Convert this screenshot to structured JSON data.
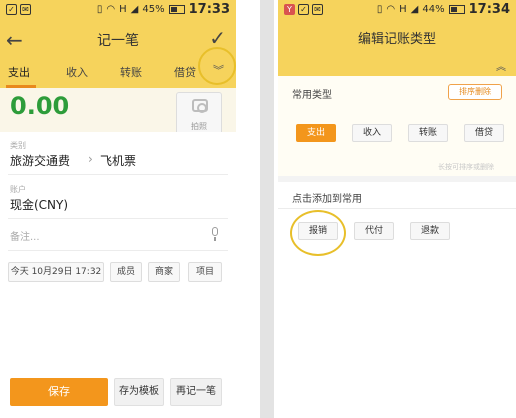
{
  "left_screen": {
    "status_bar": {
      "signal_label": "H",
      "battery_percent": "45%",
      "time": "17:33"
    },
    "header": {
      "title": "记一笔"
    },
    "tabs": [
      {
        "label": "支出",
        "active": true
      },
      {
        "label": "收入",
        "active": false
      },
      {
        "label": "转账",
        "active": false
      },
      {
        "label": "借贷",
        "active": false
      }
    ],
    "amount": "0.00",
    "photo_label": "拍照",
    "category": {
      "label": "类别",
      "main": "旅游交通费",
      "sub": "飞机票"
    },
    "account": {
      "label": "账户",
      "value": "现金(CNY)"
    },
    "note": {
      "placeholder": "备注..."
    },
    "chips": {
      "date": "今天 10月29日 17:32",
      "member": "成员",
      "merchant": "商家",
      "project": "项目"
    },
    "buttons": {
      "save": "保存",
      "save_template": "存为模板",
      "again": "再记一笔"
    }
  },
  "right_screen": {
    "status_bar": {
      "signal_label": "H",
      "battery_percent": "44%",
      "time": "17:34"
    },
    "header": {
      "title": "编辑记账类型"
    },
    "common_types": {
      "title": "常用类型",
      "sort_button": "排序删除",
      "items": [
        {
          "label": "支出",
          "active": true
        },
        {
          "label": "收入",
          "active": false
        },
        {
          "label": "转账",
          "active": false
        },
        {
          "label": "借贷",
          "active": false
        }
      ],
      "hint": "长按可排序或删除"
    },
    "add_section": {
      "title": "点击添加到常用",
      "items": [
        {
          "label": "报销"
        },
        {
          "label": "代付"
        },
        {
          "label": "退款"
        }
      ]
    }
  },
  "colors": {
    "header_yellow": "#f6d35c",
    "accent_orange": "#f3961c",
    "amount_green": "#2d9c3a",
    "callout_yellow": "#e8bf2a"
  }
}
